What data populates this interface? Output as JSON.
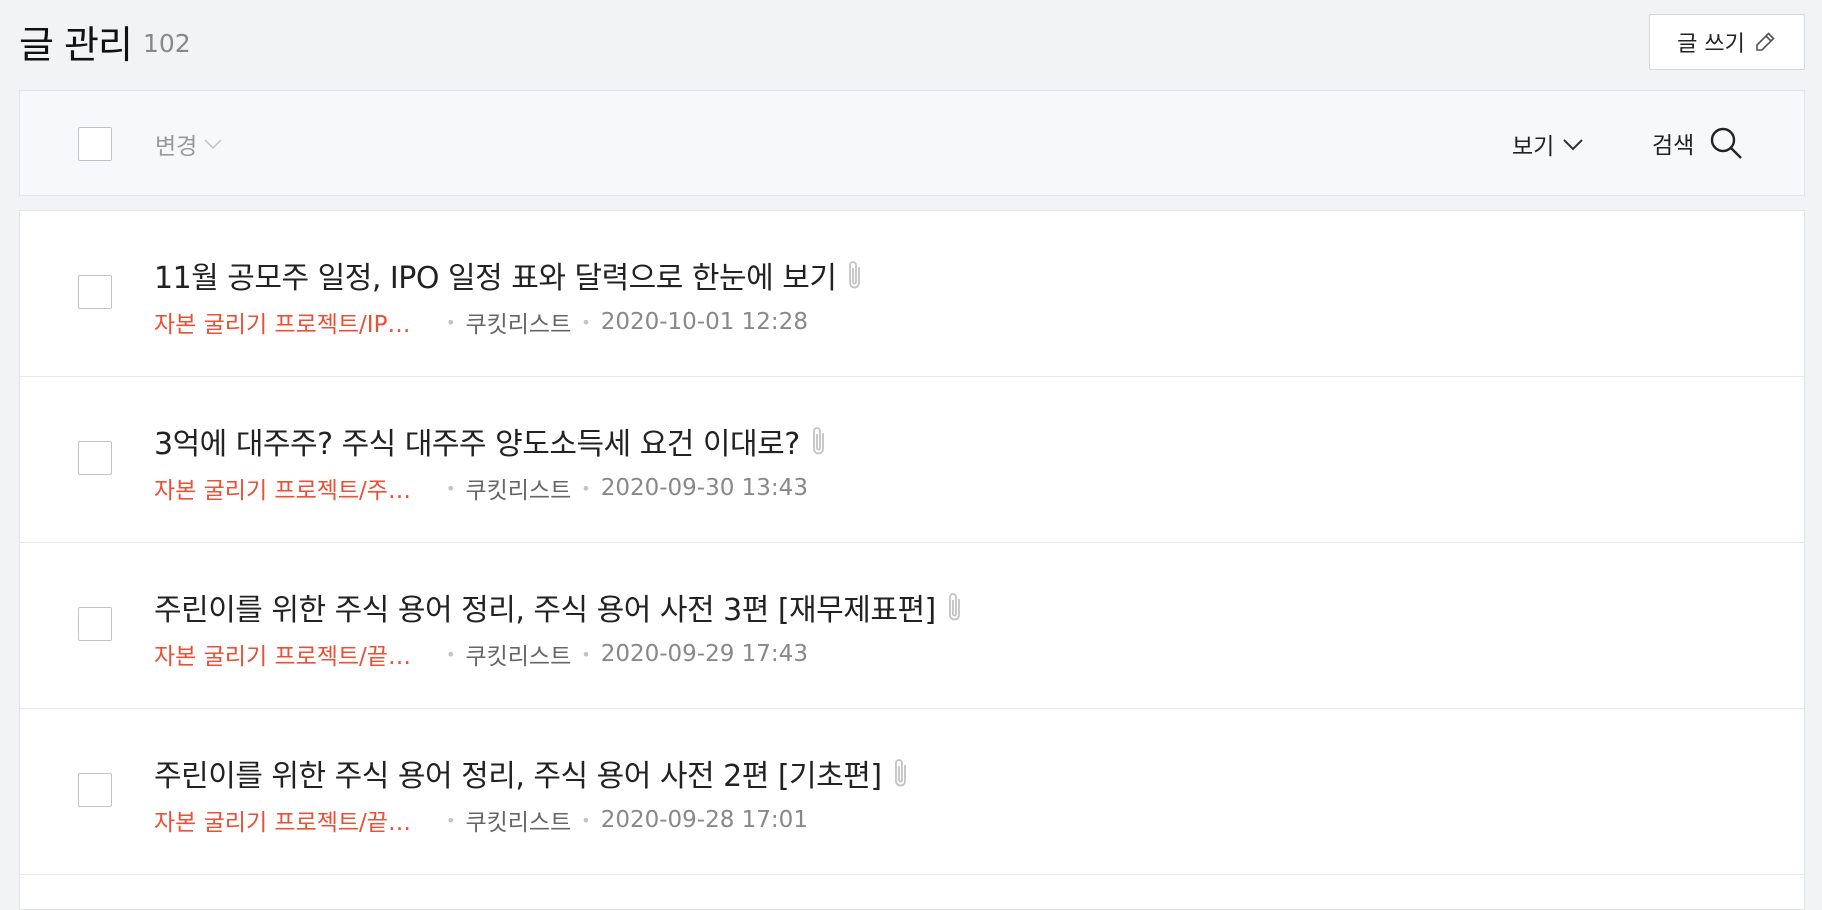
{
  "header": {
    "title": "글 관리",
    "count": "102",
    "write_label": "글 쓰기",
    "write_icon": "pencil-icon"
  },
  "toolbar": {
    "change_label": "변경",
    "view_label": "보기",
    "search_label": "검색",
    "search_icon": "search-icon"
  },
  "posts": [
    {
      "title": "11월 공모주 일정, IPO 일정 표와 달력으로 한눈에 보기",
      "category": "자본 굴리기 프로젝트/IP…",
      "author": "쿠킷리스트",
      "date": "2020-10-01 12:28",
      "has_attachment": true
    },
    {
      "title": "3억에 대주주? 주식 대주주 양도소득세 요건 이대로?",
      "category": "자본 굴리기 프로젝트/주…",
      "author": "쿠킷리스트",
      "date": "2020-09-30 13:43",
      "has_attachment": true
    },
    {
      "title": "주린이를 위한 주식 용어 정리, 주식 용어 사전 3편 [재무제표편]",
      "category": "자본 굴리기 프로젝트/끝…",
      "author": "쿠킷리스트",
      "date": "2020-09-29 17:43",
      "has_attachment": true
    },
    {
      "title": "주린이를 위한 주식 용어 정리, 주식 용어 사전 2편 [기초편]",
      "category": "자본 굴리기 프로젝트/끝…",
      "author": "쿠킷리스트",
      "date": "2020-09-28 17:01",
      "has_attachment": true
    }
  ],
  "colors": {
    "category": "#ec4f33",
    "background": "#f1f3f5",
    "toolbar_bg": "#f7f8fa"
  }
}
